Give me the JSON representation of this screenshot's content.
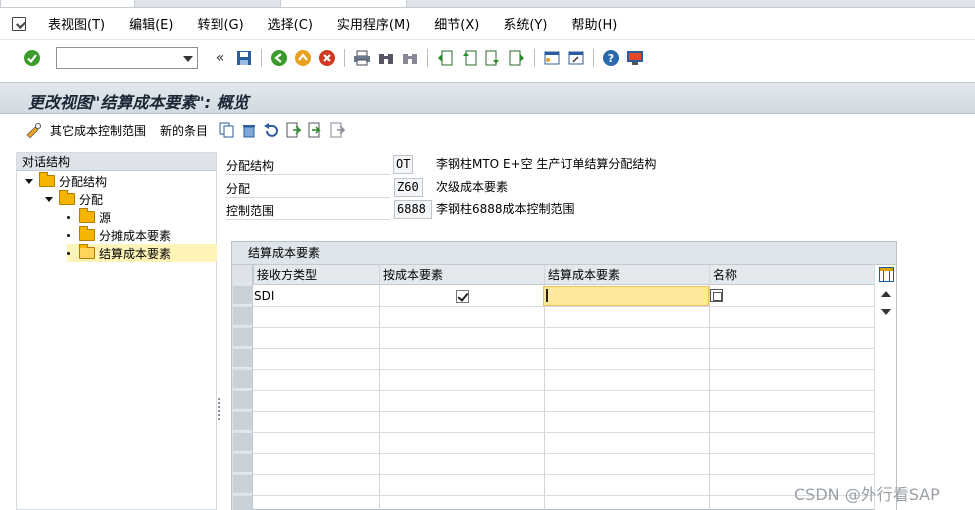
{
  "menubar": {
    "items": [
      "表视图(T)",
      "编辑(E)",
      "转到(G)",
      "选择(C)",
      "实用程序(M)",
      "细节(X)",
      "系统(Y)",
      "帮助(H)"
    ]
  },
  "toolbar": {
    "command_field_value": "",
    "icons": [
      "enter-icon",
      "save-icon",
      "back-icon",
      "exit-icon",
      "cancel-icon",
      "print-icon",
      "find-icon",
      "find-next-icon",
      "first-page-icon",
      "previous-page-icon",
      "next-page-icon",
      "last-page-icon",
      "new-session-icon",
      "shortcut-icon",
      "help-icon",
      "customize-layout-icon"
    ]
  },
  "title": "更改视图\"结算成本要素\": 概览",
  "app_toolbar": {
    "other_area_label": "其它成本控制范围",
    "new_entries_label": "新的条目"
  },
  "tree": {
    "header": "对话结构",
    "nodes": [
      {
        "label": "分配结构",
        "level": 0
      },
      {
        "label": "分配",
        "level": 1
      },
      {
        "label": "源",
        "level": 2
      },
      {
        "label": "分摊成本要素",
        "level": 2
      },
      {
        "label": "结算成本要素",
        "level": 2,
        "selected": true
      }
    ]
  },
  "header_fields": [
    {
      "label": "分配结构",
      "value": "OT",
      "description": "李钢柱MTO E+空 生产订单结算分配结构"
    },
    {
      "label": "分配",
      "value": "Z60",
      "description": "次级成本要素"
    },
    {
      "label": "控制范围",
      "value": "6888",
      "description": "李钢柱6888成本控制范围"
    }
  ],
  "table": {
    "title": "结算成本要素",
    "columns": [
      "接收方类型",
      "按成本要素",
      "结算成本要素",
      "名称"
    ],
    "rows": [
      {
        "receiver_type": "SDI",
        "by_cost_element": true,
        "settlement_cost_element": "",
        "name": ""
      }
    ]
  },
  "watermark": "CSDN @外行看SAP",
  "colors": {
    "title_bar": "#d2dae2",
    "active_cell": "#ffe89a",
    "selected_node": "#fff4b8",
    "folder": "#f4b400"
  }
}
